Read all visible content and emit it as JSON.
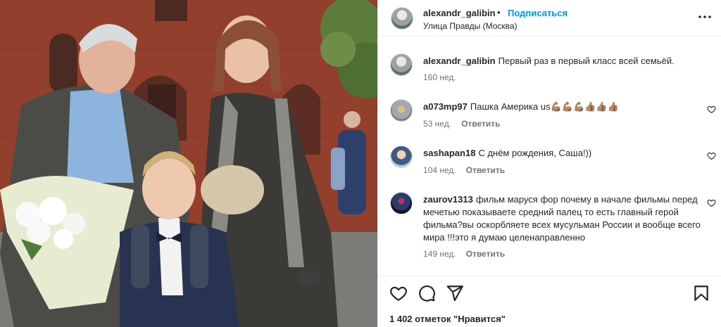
{
  "post": {
    "author": "alexandr_galibin",
    "separator": "•",
    "follow_label": "Подписаться",
    "location": "Улица Правды (Москва)",
    "more_icon": "more-horizontal-icon"
  },
  "caption": {
    "user": "alexandr_galibin",
    "text": "Первый раз в первый класс всей семьёй.",
    "time": "160 нед."
  },
  "comments": [
    {
      "user": "a073mp97",
      "text": "Пашка Америка us💪🏽💪🏽💪🏽👍🏽👍🏽👍🏽",
      "time": "53 нед.",
      "reply": "Ответить"
    },
    {
      "user": "sashapan18",
      "text": "С днём рождения, Саша!))",
      "time": "104 нед.",
      "reply": "Ответить"
    },
    {
      "user": "zaurov1313",
      "text": "фильм маруся фор почему в начале фильмы перед мечетью показываете средний палец то есть главный герой фильма?вы оскорбляете всех мусульман России и вообще всего мира !!!это я думаю целенаправленно",
      "time": "149 нед.",
      "reply": "Ответить"
    }
  ],
  "actions": {
    "like_icon": "heart-icon",
    "comment_icon": "comment-icon",
    "share_icon": "send-icon",
    "save_icon": "bookmark-icon"
  },
  "likes_text": "1 402 отметок \"Нравится\"",
  "colors": {
    "link_blue": "#0095f6",
    "meta_gray": "#737373",
    "text": "#262626",
    "divider": "#efefef"
  }
}
